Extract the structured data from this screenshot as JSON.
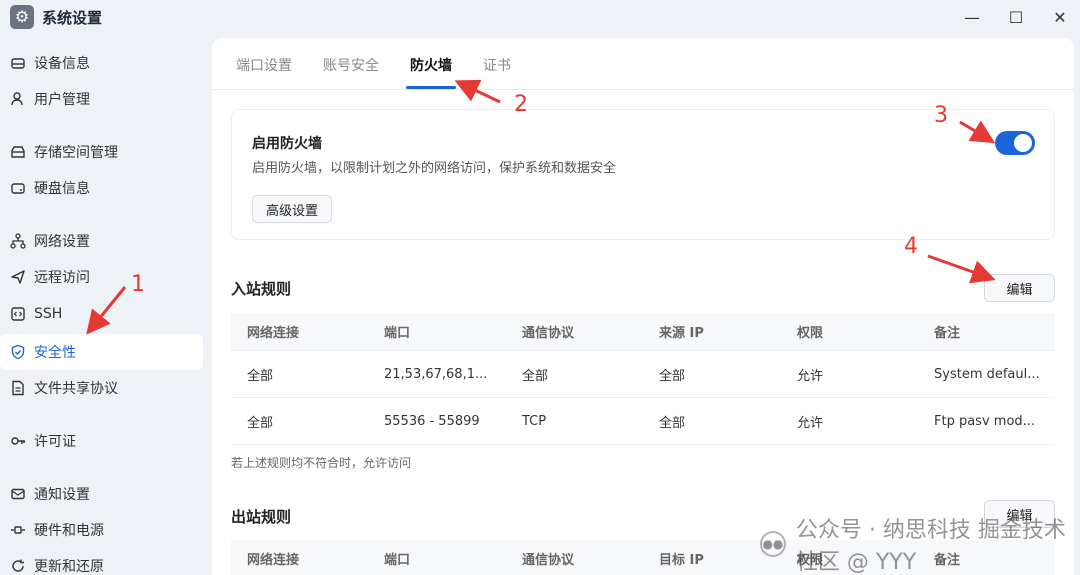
{
  "window": {
    "title": "系统设置",
    "controls": {
      "minimize": "—",
      "maximize": "☐",
      "close": "✕"
    }
  },
  "sidebar": {
    "items": [
      {
        "label": "设备信息",
        "icon": "device-icon"
      },
      {
        "label": "用户管理",
        "icon": "user-icon"
      },
      {
        "label": "存储空间管理",
        "icon": "storage-icon"
      },
      {
        "label": "硬盘信息",
        "icon": "disk-icon"
      },
      {
        "label": "网络设置",
        "icon": "network-icon"
      },
      {
        "label": "远程访问",
        "icon": "send-icon"
      },
      {
        "label": "SSH",
        "icon": "code-icon"
      },
      {
        "label": "安全性",
        "icon": "shield-icon",
        "active": true
      },
      {
        "label": "文件共享协议",
        "icon": "file-icon"
      },
      {
        "label": "许可证",
        "icon": "key-icon"
      },
      {
        "label": "通知设置",
        "icon": "mail-icon"
      },
      {
        "label": "硬件和电源",
        "icon": "hardware-icon"
      },
      {
        "label": "更新和还原",
        "icon": "refresh-icon"
      }
    ]
  },
  "tabs": [
    {
      "label": "端口设置"
    },
    {
      "label": "账号安全"
    },
    {
      "label": "防火墙",
      "active": true
    },
    {
      "label": "证书"
    }
  ],
  "firewall": {
    "title": "启用防火墙",
    "description": "启用防火墙，以限制计划之外的网络访问，保护系统和数据安全",
    "advanced_button": "高级设置",
    "enabled": true
  },
  "inbound": {
    "title": "入站规则",
    "edit_button": "编辑",
    "columns": [
      "网络连接",
      "端口",
      "通信协议",
      "来源 IP",
      "权限",
      "备注"
    ],
    "rows": [
      [
        "全部",
        "21,53,67,68,1...",
        "全部",
        "全部",
        "允许",
        "System defaul..."
      ],
      [
        "全部",
        "55536 - 55899",
        "TCP",
        "全部",
        "允许",
        "Ftp pasv mod..."
      ]
    ],
    "note": "若上述规则均不符合时，允许访问"
  },
  "outbound": {
    "title": "出站规则",
    "edit_button": "编辑",
    "columns": [
      "网络连接",
      "端口",
      "通信协议",
      "目标 IP",
      "权限",
      "备注"
    ]
  },
  "annotations": [
    "1",
    "2",
    "3",
    "4"
  ],
  "watermark": {
    "text": "公众号 · 纳思科技 掘金技术社区 @ YYY"
  },
  "colors": {
    "accent": "#1a66d9",
    "annotation": "#e53935"
  }
}
